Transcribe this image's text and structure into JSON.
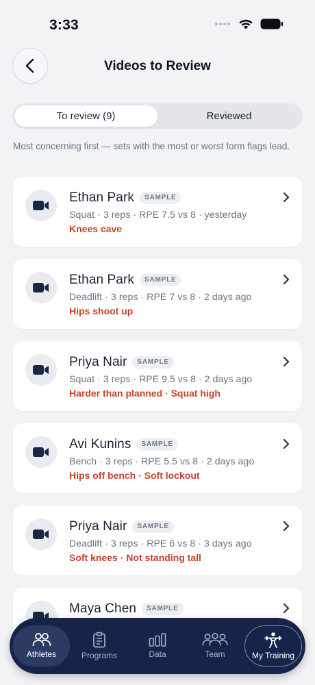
{
  "status_bar": {
    "time": "3:33"
  },
  "header": {
    "title": "Videos to Review"
  },
  "segments": [
    {
      "label": "To review (9)",
      "active": true
    },
    {
      "label": "Reviewed",
      "active": false
    }
  ],
  "intro": "Most concerning first — sets with the most or worst form flags lead.",
  "badge_label": "SAMPLE",
  "videos": [
    {
      "name": "Ethan Park",
      "meta": "Squat · 3 reps · RPE 7.5 vs 8 · yesterday",
      "flags": "Knees cave"
    },
    {
      "name": "Ethan Park",
      "meta": "Deadlift · 3 reps · RPE 7 vs 8 · 2 days ago",
      "flags": "Hips shoot up"
    },
    {
      "name": "Priya Nair",
      "meta": "Squat · 3 reps · RPE 9.5 vs 8 · 2 days ago",
      "flags": "Harder than planned · Squat high"
    },
    {
      "name": "Avi Kunins",
      "meta": "Bench · 3 reps · RPE 5.5 vs 8 · 2 days ago",
      "flags": "Hips off bench · Soft lockout"
    },
    {
      "name": "Priya Nair",
      "meta": "Deadlift · 3 reps · RPE 6 vs 8 · 3 days ago",
      "flags": "Soft knees · Not standing tall"
    },
    {
      "name": "Maya Chen",
      "meta": "",
      "flags": ""
    }
  ],
  "tabs": [
    {
      "label": "Athletes",
      "icon": "athletes-icon",
      "active": true
    },
    {
      "label": "Programs",
      "icon": "clipboard-icon",
      "active": false
    },
    {
      "label": "Data",
      "icon": "bar-chart-icon",
      "active": false
    },
    {
      "label": "Team",
      "icon": "team-icon",
      "active": false
    },
    {
      "label": "My Training",
      "icon": "weightlifter-icon",
      "active": false
    }
  ],
  "colors": {
    "background": "#f2f3f5",
    "card": "#ffffff",
    "flag_red": "#c4422e",
    "tab_bar": "#16244a",
    "text_dark": "#1b2233",
    "text_muted": "#6a7382"
  }
}
